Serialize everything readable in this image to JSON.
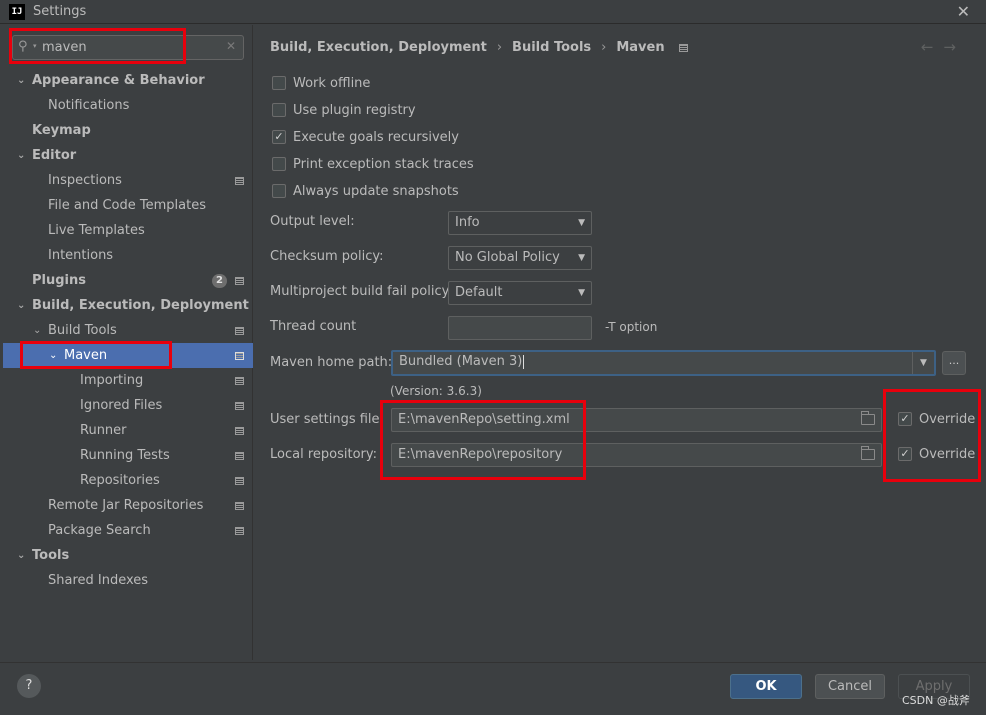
{
  "window": {
    "title": "Settings",
    "icon_text": "IJ"
  },
  "search": {
    "value": "maven"
  },
  "sidebar": {
    "items": [
      {
        "label": "Appearance & Behavior"
      },
      {
        "label": "Notifications"
      },
      {
        "label": "Keymap"
      },
      {
        "label": "Editor"
      },
      {
        "label": "Inspections"
      },
      {
        "label": "File and Code Templates"
      },
      {
        "label": "Live Templates"
      },
      {
        "label": "Intentions"
      },
      {
        "label": "Plugins",
        "badge": "2"
      },
      {
        "label": "Build, Execution, Deployment"
      },
      {
        "label": "Build Tools"
      },
      {
        "label": "Maven"
      },
      {
        "label": "Importing"
      },
      {
        "label": "Ignored Files"
      },
      {
        "label": "Runner"
      },
      {
        "label": "Running Tests"
      },
      {
        "label": "Repositories"
      },
      {
        "label": "Remote Jar Repositories"
      },
      {
        "label": "Package Search"
      },
      {
        "label": "Tools"
      },
      {
        "label": "Shared Indexes"
      }
    ]
  },
  "breadcrumb": {
    "items": [
      "Build, Execution, Deployment",
      "Build Tools",
      "Maven"
    ],
    "separator": "›"
  },
  "nav": {
    "back": "←",
    "forward": "→"
  },
  "options": [
    {
      "label": "Work offline",
      "checked": false
    },
    {
      "label": "Use plugin registry",
      "checked": false
    },
    {
      "label": "Execute goals recursively",
      "checked": true
    },
    {
      "label": "Print exception stack traces",
      "checked": false
    },
    {
      "label": "Always update snapshots",
      "checked": false
    }
  ],
  "form": {
    "output_level": {
      "label": "Output level:",
      "value": "Info"
    },
    "checksum_policy": {
      "label": "Checksum policy:",
      "value": "No Global Policy"
    },
    "multiproject": {
      "label": "Multiproject build fail policy:",
      "value": "Default"
    },
    "thread_count": {
      "label": "Thread count",
      "value": "",
      "hint": "-T option"
    },
    "maven_home": {
      "label": "Maven home path:",
      "value": "Bundled (Maven 3)",
      "button": "...",
      "version": "(Version: 3.6.3)"
    },
    "user_settings": {
      "label": "User settings file:",
      "value": "E:\\mavenRepo\\setting.xml",
      "override": "Override",
      "checked": true
    },
    "local_repo": {
      "label": "Local repository:",
      "value": "E:\\mavenRepo\\repository",
      "override": "Override",
      "checked": true
    }
  },
  "footer": {
    "help": "?",
    "ok": "OK",
    "cancel": "Cancel",
    "apply": "Apply",
    "watermark": "CSDN @战斧"
  },
  "colors": {
    "highlight": "#e8000c",
    "selection": "#4b6eaf",
    "ok_button": "#365880"
  }
}
